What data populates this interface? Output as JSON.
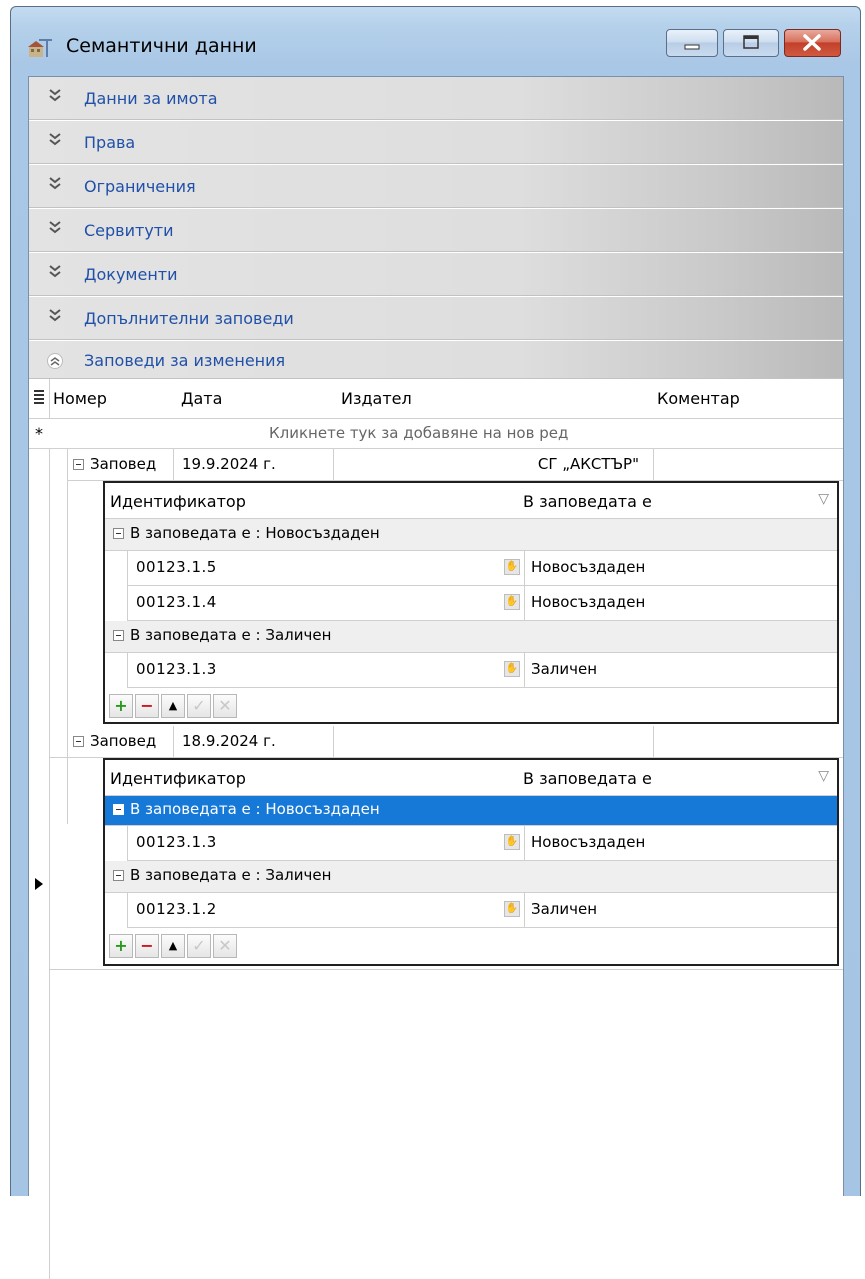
{
  "window": {
    "title": "Семантични данни",
    "icon": "building-crane-icon",
    "controls": [
      "minimize-button",
      "maximize-button",
      "close-button"
    ]
  },
  "sections": [
    {
      "label": "Данни за имота",
      "expanded": false
    },
    {
      "label": "Права",
      "expanded": false
    },
    {
      "label": "Ограничения",
      "expanded": false
    },
    {
      "label": "Сервитути",
      "expanded": false
    },
    {
      "label": "Документи",
      "expanded": false
    },
    {
      "label": "Допълнителни заповеди",
      "expanded": false
    },
    {
      "label": "Заповеди за изменения",
      "expanded": true
    }
  ],
  "grid": {
    "columns": [
      "Номер",
      "Дата",
      "Издател",
      "Коментар"
    ],
    "new_row_placeholder": "Кликнете тук за добавяне на нов ред",
    "new_row_marker": "*",
    "rows": [
      {
        "number": "Заповед",
        "date": "19.9.2024 г.",
        "issuer": "СГ „АКСТЪР\"",
        "comment": "",
        "detail": {
          "columns": [
            "Идентификатор",
            "В заповедата е"
          ],
          "groups": [
            {
              "label": "В заповедата е : Новосъздаден",
              "items": [
                {
                  "id": "00123.1.5",
                  "status": "Новосъздаден"
                },
                {
                  "id": "00123.1.4",
                  "status": "Новосъздаден"
                }
              ]
            },
            {
              "label": "В заповедата е : Заличен",
              "items": [
                {
                  "id": "00123.1.3",
                  "status": "Заличен"
                }
              ]
            }
          ]
        }
      },
      {
        "number": "Заповед",
        "date": "18.9.2024 г.",
        "issuer": "",
        "comment": "",
        "detail": {
          "columns": [
            "Идентификатор",
            "В заповедата е"
          ],
          "groups": [
            {
              "label": "В заповедата е : Новосъздаден",
              "selected": true,
              "items": [
                {
                  "id": "00123.1.3",
                  "status": "Новосъздаден"
                }
              ]
            },
            {
              "label": "В заповедата е : Заличен",
              "items": [
                {
                  "id": "00123.1.2",
                  "status": "Заличен"
                }
              ]
            }
          ]
        }
      }
    ]
  },
  "colors": {
    "accent_text": "#2050a8",
    "selection": "#1679d7",
    "add": "#2a9a1e",
    "remove": "#d0101a"
  }
}
